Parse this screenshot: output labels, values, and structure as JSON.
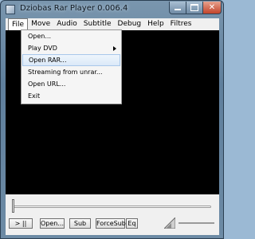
{
  "window": {
    "title": "Dziobas Rar Player 0.006.4"
  },
  "menubar": [
    "File",
    "Move",
    "Audio",
    "Subtitle",
    "Debug",
    "Help",
    "Filtres"
  ],
  "file_menu": {
    "items": [
      "Open...",
      "Play DVD",
      "Open RAR...",
      "Streaming from unrar...",
      "Open URL...",
      "Exit"
    ],
    "highlighted": "Open RAR..."
  },
  "controls": {
    "play_pause": "> ||",
    "open": "Open...",
    "sub": "Sub",
    "force_sub": "ForceSub.",
    "eq": "Eq"
  },
  "colors": {
    "close_button": "#c2452b",
    "menu_highlight": "#dbe9f8",
    "video_background": "#000000"
  }
}
